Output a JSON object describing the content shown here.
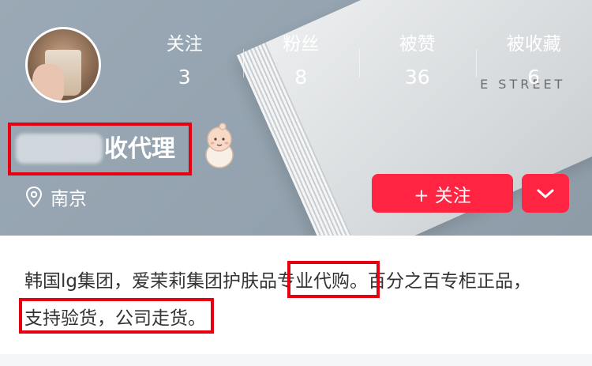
{
  "profile": {
    "name_suffix": "收代理",
    "location": "南京"
  },
  "stats": [
    {
      "label": "关注",
      "value": "3"
    },
    {
      "label": "粉丝",
      "value": "8"
    },
    {
      "label": "被赞",
      "value": "36"
    },
    {
      "label": "被收藏",
      "value": "6"
    }
  ],
  "actions": {
    "follow_label": "+ 关注"
  },
  "cover": {
    "street_text": "E STREET"
  },
  "bio": {
    "line1": "韩国lg集团，爱茉莉集团护肤品专业代购。百分之百专柜正品，",
    "line2": "支持验货，公司走货。"
  },
  "colors": {
    "accent": "#ff2442",
    "highlight_border": "#e60012"
  },
  "icons": {
    "location": "map-pin-icon",
    "more": "chevron-down-icon",
    "sticker": "baby-sticker-icon"
  }
}
